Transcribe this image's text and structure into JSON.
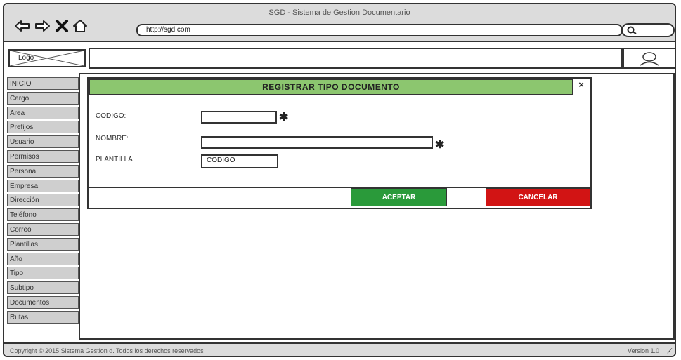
{
  "window": {
    "title": "SGD - Sistema de Gestion Documentario"
  },
  "browser": {
    "url": "http://sgd.com"
  },
  "header": {
    "logo": "Logo"
  },
  "sidebar": {
    "items": [
      {
        "label": "INICIO"
      },
      {
        "label": "Cargo"
      },
      {
        "label": "Area"
      },
      {
        "label": "Prefijos"
      },
      {
        "label": "Usuario"
      },
      {
        "label": "Permisos"
      },
      {
        "label": "Persona"
      },
      {
        "label": "Empresa"
      },
      {
        "label": "Dirección"
      },
      {
        "label": "Teléfono"
      },
      {
        "label": "Correo"
      },
      {
        "label": "Plantillas"
      },
      {
        "label": "Año"
      },
      {
        "label": "Tipo"
      },
      {
        "label": "Subtipo"
      },
      {
        "label": "Documentos"
      },
      {
        "label": "Rutas"
      }
    ]
  },
  "dialog": {
    "title": "REGISTRAR TIPO DOCUMENTO",
    "close": "×",
    "fields": {
      "codigo_label": "CODIGO:",
      "codigo_value": "",
      "nombre_label": "NOMBRE:",
      "nombre_value": "",
      "plantilla_label": "PLANTILLA",
      "plantilla_value": "CODIGO",
      "required_mark": "✱"
    },
    "accept_label": "ACEPTAR",
    "cancel_label": "CANCELAR",
    "colors": {
      "header": "#8cc66f",
      "accept": "#2a9a3a",
      "cancel": "#d21414"
    }
  },
  "footer": {
    "copyright": "Copyright © 2015 Sistema Gestion d. Todos los derechos reservados",
    "version": "Version 1.0"
  }
}
